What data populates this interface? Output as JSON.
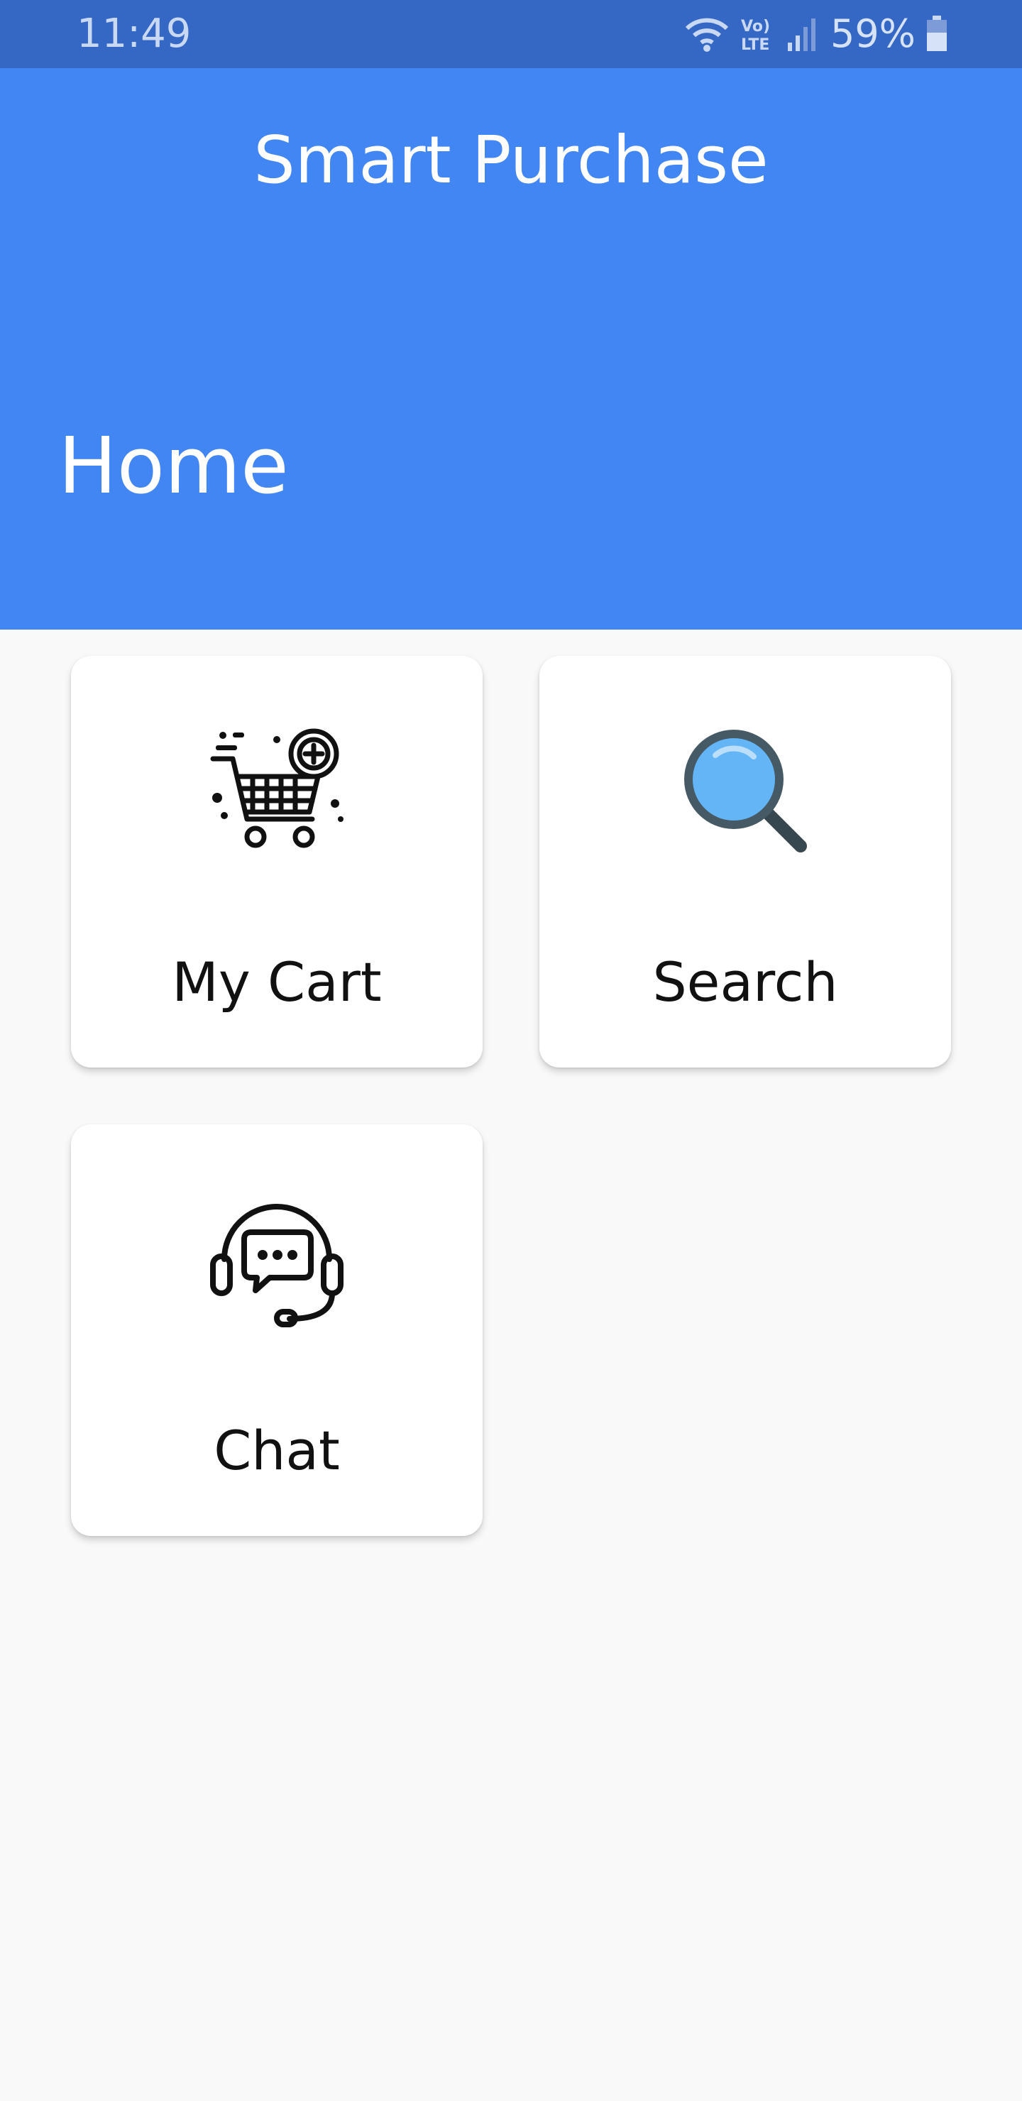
{
  "status_bar": {
    "time": "11:49",
    "battery": "59%",
    "icons": [
      "wifi-icon",
      "volte-icon",
      "signal-icon",
      "battery-icon"
    ],
    "background": "#3567c4"
  },
  "app_bar": {
    "title": "Smart Purchase",
    "page_title": "Home",
    "background": "#4286f4"
  },
  "cards": [
    {
      "label": "My Cart",
      "icon": "shopping-cart-icon"
    },
    {
      "label": "Search",
      "icon": "magnifier-icon"
    },
    {
      "label": "Chat",
      "icon": "headset-chat-icon"
    }
  ]
}
